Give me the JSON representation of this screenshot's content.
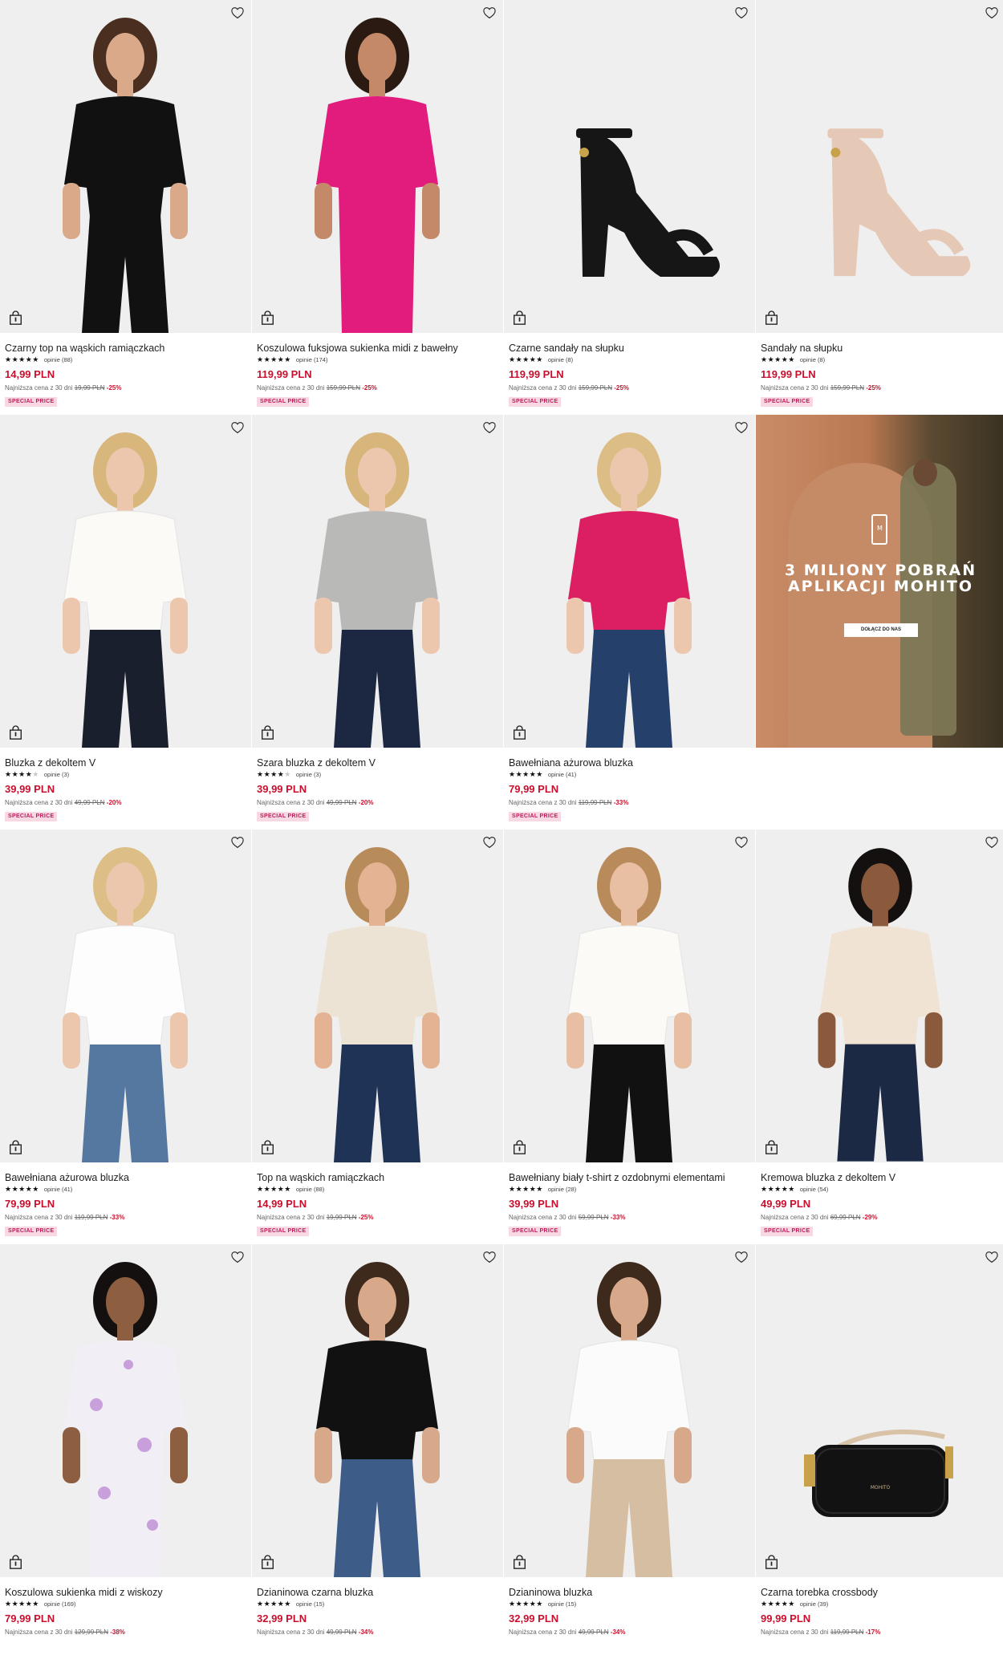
{
  "colors": {
    "price": "#c8102e",
    "badge_bg": "#f8d9e3",
    "badge_text": "#c2185b",
    "image_bg": "#efefef"
  },
  "icons": {
    "wishlist": "heart-icon",
    "add_to_cart": "shopping-bag-icon"
  },
  "products": [
    {
      "name": "Czarny top na wąskich ramiączkach",
      "stars": 5,
      "reviews": "opinie (88)",
      "price": "14,99 PLN",
      "lowest_label": "Najniższa cena z 30 dni",
      "old_price": "19,99 PLN",
      "discount": "-25%",
      "badge": "SPECIAL PRICE",
      "image": "black-camisole"
    },
    {
      "name": "Koszulowa fuksjowa sukienka midi z bawełny",
      "stars": 4.5,
      "reviews": "opinie (174)",
      "price": "119,99 PLN",
      "lowest_label": "Najniższa cena z 30 dni",
      "old_price": "159,99 PLN",
      "discount": "-25%",
      "badge": "SPECIAL PRICE",
      "image": "fuchsia-dress"
    },
    {
      "name": "Czarne sandały na słupku",
      "stars": 5,
      "reviews": "opinie (8)",
      "price": "119,99 PLN",
      "lowest_label": "Najniższa cena z 30 dni",
      "old_price": "159,99 PLN",
      "discount": "-25%",
      "badge": "SPECIAL PRICE",
      "image": "black-sandal"
    },
    {
      "name": "Sandały na słupku",
      "stars": 5,
      "reviews": "opinie (8)",
      "price": "119,99 PLN",
      "lowest_label": "Najniższa cena z 30 dni",
      "old_price": "159,99 PLN",
      "discount": "-25%",
      "badge": "SPECIAL PRICE",
      "image": "nude-sandal"
    },
    {
      "name": "Bluzka z dekoltem V",
      "stars": 4,
      "reviews": "opinie (3)",
      "price": "39,99 PLN",
      "lowest_label": "Najniższa cena z 30 dni",
      "old_price": "49,99 PLN",
      "discount": "-20%",
      "badge": "SPECIAL PRICE",
      "image": "white-vneck"
    },
    {
      "name": "Szara bluzka z dekoltem V",
      "stars": 4,
      "reviews": "opinie (3)",
      "price": "39,99 PLN",
      "lowest_label": "Najniższa cena z 30 dni",
      "old_price": "49,99 PLN",
      "discount": "-20%",
      "badge": "SPECIAL PRICE",
      "image": "grey-vneck"
    },
    {
      "name": "Bawełniana ażurowa bluzka",
      "stars": 5,
      "reviews": "opinie (41)",
      "price": "79,99 PLN",
      "lowest_label": "Najniższa cena z 30 dni",
      "old_price": "119,99 PLN",
      "discount": "-33%",
      "badge": "SPECIAL PRICE",
      "image": "pink-eyelet"
    },
    {
      "promo": true,
      "promo_title_1": "3 MILIONY POBRAŃ",
      "promo_title_2": "APLIKACJI MOHITO",
      "promo_cta": "DOŁĄCZ DO NAS",
      "logo": "M"
    },
    {
      "name": "Bawełniana ażurowa bluzka",
      "stars": 5,
      "reviews": "opinie (41)",
      "price": "79,99 PLN",
      "lowest_label": "Najniższa cena z 30 dni",
      "old_price": "119,99 PLN",
      "discount": "-33%",
      "badge": "SPECIAL PRICE",
      "image": "white-eyelet"
    },
    {
      "name": "Top na wąskich ramiączkach",
      "stars": 5,
      "reviews": "opinie (88)",
      "price": "14,99 PLN",
      "lowest_label": "Najniższa cena z 30 dni",
      "old_price": "19,99 PLN",
      "discount": "-25%",
      "badge": "SPECIAL PRICE",
      "image": "cream-camisole"
    },
    {
      "name": "Bawełniany biały t-shirt z ozdobnymi elementami",
      "stars": 4.5,
      "reviews": "opinie (28)",
      "price": "39,99 PLN",
      "lowest_label": "Najniższa cena z 30 dni",
      "old_price": "59,99 PLN",
      "discount": "-33%",
      "badge": "SPECIAL PRICE",
      "image": "white-tee"
    },
    {
      "name": "Kremowa bluzka z dekoltem V",
      "stars": 4.5,
      "reviews": "opinie (54)",
      "price": "49,99 PLN",
      "lowest_label": "Najniższa cena z 30 dni",
      "old_price": "69,99 PLN",
      "discount": "-29%",
      "badge": "SPECIAL PRICE",
      "image": "cream-vneck"
    },
    {
      "name": "Koszulowa sukienka midi z wiskozy",
      "stars": 5,
      "reviews": "opinie (169)",
      "price": "79,99 PLN",
      "lowest_label": "Najniższa cena z 30 dni",
      "old_price": "129,99 PLN",
      "discount": "-38%",
      "badge": "",
      "image": "floral-dress"
    },
    {
      "name": "Dzianinowa czarna bluzka",
      "stars": 4.5,
      "reviews": "opinie (15)",
      "price": "32,99 PLN",
      "lowest_label": "Najniższa cena z 30 dni",
      "old_price": "49,99 PLN",
      "discount": "-34%",
      "badge": "",
      "image": "black-knit"
    },
    {
      "name": "Dzianinowa bluzka",
      "stars": 4.5,
      "reviews": "opinie (15)",
      "price": "32,99 PLN",
      "lowest_label": "Najniższa cena z 30 dni",
      "old_price": "49,99 PLN",
      "discount": "-34%",
      "badge": "",
      "image": "white-knit"
    },
    {
      "name": "Czarna torebka crossbody",
      "stars": 5,
      "reviews": "opinie (39)",
      "price": "99,99 PLN",
      "lowest_label": "Najniższa cena z 30 dni",
      "old_price": "119,99 PLN",
      "discount": "-17%",
      "badge": "",
      "image": "black-crossbody"
    }
  ]
}
